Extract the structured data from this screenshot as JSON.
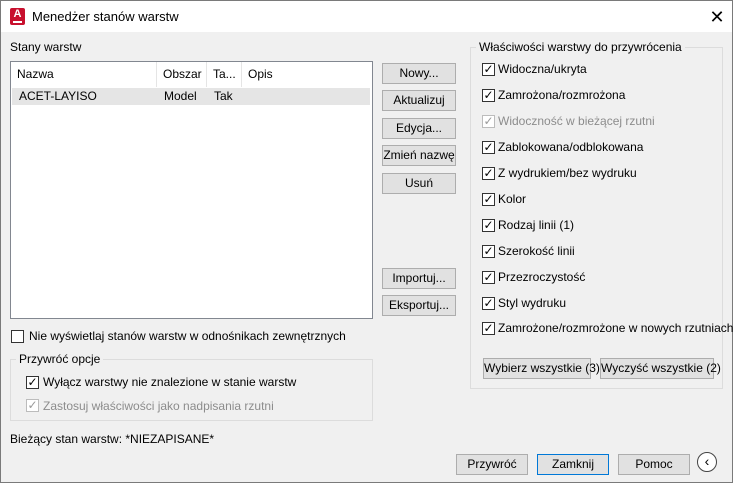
{
  "window": {
    "title": "Menedżer stanów warstw"
  },
  "icons": {
    "app": "autocad-app-icon",
    "close": "close-icon",
    "collapse": "chevron-left-icon"
  },
  "states": {
    "label": "Stany warstw",
    "columns": [
      "Nazwa",
      "Obszar",
      "Ta...",
      "Opis"
    ],
    "rows": [
      {
        "name": "ACET-LAYISO",
        "space": "Model",
        "ta": "Tak",
        "desc": ""
      }
    ]
  },
  "buttons": {
    "new": "Nowy...",
    "update": "Aktualizuj",
    "edit": "Edycja...",
    "rename": "Zmień nazwę",
    "delete": "Usuń",
    "import": "Importuj...",
    "export": "Eksportuj...",
    "select_all": "Wybierz wszystkie (3)",
    "clear_all": "Wyczyść wszystkie (2)",
    "restore": "Przywróć",
    "close": "Zamknij",
    "help": "Pomoc"
  },
  "no_xref": {
    "label": "Nie wyświetlaj stanów warstw w odnośnikach zewnętrznych",
    "checked": false
  },
  "restore_options": {
    "title": "Przywróć opcje",
    "turn_off": {
      "label": "Wyłącz warstwy nie znalezione w stanie warstw",
      "checked": true
    },
    "apply_overrides": {
      "label": "Zastosuj właściwości jako nadpisania rzutni",
      "checked": true,
      "disabled": true
    }
  },
  "properties": {
    "title": "Właściwości warstwy do przywrócenia",
    "items": [
      {
        "label": "Widoczna/ukryta",
        "checked": true,
        "disabled": false
      },
      {
        "label": "Zamrożona/rozmrożona",
        "checked": true,
        "disabled": false
      },
      {
        "label": "Widoczność w bieżącej rzutni",
        "checked": true,
        "disabled": true
      },
      {
        "label": "Zablokowana/odblokowana",
        "checked": true,
        "disabled": false
      },
      {
        "label": "Z wydrukiem/bez wydruku",
        "checked": true,
        "disabled": false
      },
      {
        "label": "Kolor",
        "checked": true,
        "disabled": false
      },
      {
        "label": "Rodzaj linii (1)",
        "checked": true,
        "disabled": false
      },
      {
        "label": "Szerokość linii",
        "checked": true,
        "disabled": false
      },
      {
        "label": "Przezroczystość",
        "checked": true,
        "disabled": false
      },
      {
        "label": "Styl wydruku",
        "checked": true,
        "disabled": false
      },
      {
        "label": "Zamrożone/rozmrożone w nowych rzutniach",
        "checked": true,
        "disabled": false
      }
    ]
  },
  "current_state": "Bieżący stan warstw: *NIEZAPISANE*"
}
